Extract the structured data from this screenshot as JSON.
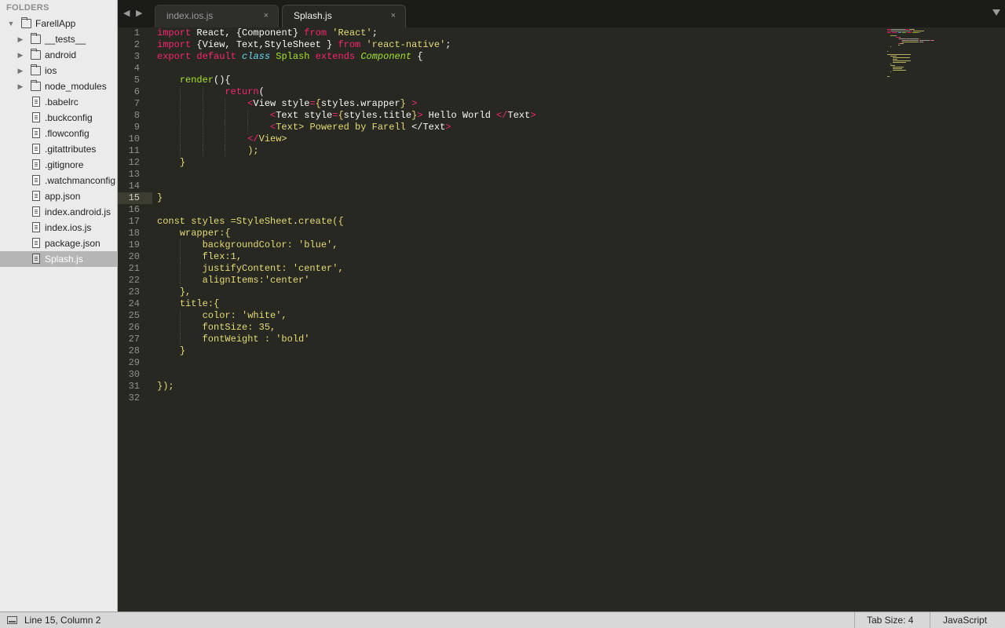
{
  "sidebar": {
    "header": "FOLDERS",
    "items": [
      {
        "label": "FarellApp",
        "type": "folder",
        "expanded": true,
        "depth": 0
      },
      {
        "label": "__tests__",
        "type": "folder",
        "expanded": false,
        "depth": 1
      },
      {
        "label": "android",
        "type": "folder",
        "expanded": false,
        "depth": 1
      },
      {
        "label": "ios",
        "type": "folder",
        "expanded": false,
        "depth": 1
      },
      {
        "label": "node_modules",
        "type": "folder",
        "expanded": false,
        "depth": 1
      },
      {
        "label": ".babelrc",
        "type": "file",
        "depth": 1
      },
      {
        "label": ".buckconfig",
        "type": "file",
        "depth": 1
      },
      {
        "label": ".flowconfig",
        "type": "file",
        "depth": 1
      },
      {
        "label": ".gitattributes",
        "type": "file",
        "depth": 1
      },
      {
        "label": ".gitignore",
        "type": "file",
        "depth": 1
      },
      {
        "label": ".watchmanconfig",
        "type": "file",
        "depth": 1
      },
      {
        "label": "app.json",
        "type": "file",
        "depth": 1
      },
      {
        "label": "index.android.js",
        "type": "file",
        "depth": 1
      },
      {
        "label": "index.ios.js",
        "type": "file",
        "depth": 1
      },
      {
        "label": "package.json",
        "type": "file",
        "depth": 1
      },
      {
        "label": "Splash.js",
        "type": "file",
        "depth": 1,
        "selected": true
      }
    ]
  },
  "tabs": [
    {
      "label": "index.ios.js",
      "active": false,
      "close": "×"
    },
    {
      "label": "Splash.js",
      "active": true,
      "close": "×"
    }
  ],
  "nav": {
    "back": "◀",
    "forward": "▶"
  },
  "editor": {
    "current_line": 15,
    "lines": [
      [
        [
          "kw",
          "import"
        ],
        [
          "plain",
          " React, {Component} "
        ],
        [
          "kw",
          "from"
        ],
        [
          "plain",
          " "
        ],
        [
          "str",
          "'React'"
        ],
        [
          "plain",
          ";"
        ]
      ],
      [
        [
          "kw",
          "import"
        ],
        [
          "plain",
          " {View, Text,StyleSheet } "
        ],
        [
          "kw",
          "from"
        ],
        [
          "plain",
          " "
        ],
        [
          "str",
          "'react-native'"
        ],
        [
          "plain",
          ";"
        ]
      ],
      [
        [
          "kw",
          "export"
        ],
        [
          "plain",
          " "
        ],
        [
          "kw",
          "default"
        ],
        [
          "plain",
          " "
        ],
        [
          "it",
          "class"
        ],
        [
          "plain",
          " "
        ],
        [
          "cls",
          "Splash"
        ],
        [
          "plain",
          " "
        ],
        [
          "kw",
          "extends"
        ],
        [
          "plain",
          " "
        ],
        [
          "itg",
          "Component"
        ],
        [
          "plain",
          " {"
        ]
      ],
      [],
      [
        [
          "plain",
          "    "
        ],
        [
          "fn",
          "render"
        ],
        [
          "plain",
          "(){"
        ]
      ],
      [
        [
          "plain",
          "            "
        ],
        [
          "kw",
          "return"
        ],
        [
          "plain",
          "("
        ]
      ],
      [
        [
          "plain",
          "                "
        ],
        [
          "kw",
          "<"
        ],
        [
          "plain",
          "View style"
        ],
        [
          "kw",
          "="
        ],
        [
          "cur",
          "{"
        ],
        [
          "plain",
          "styles.wrapper"
        ],
        [
          "cur",
          "}"
        ],
        [
          "plain",
          " "
        ],
        [
          "kw",
          ">"
        ]
      ],
      [
        [
          "plain",
          "                    "
        ],
        [
          "kw",
          "<"
        ],
        [
          "plain",
          "Text style"
        ],
        [
          "kw",
          "="
        ],
        [
          "cur",
          "{"
        ],
        [
          "plain",
          "styles.title"
        ],
        [
          "cur",
          "}"
        ],
        [
          "kw",
          ">"
        ],
        [
          "plain",
          " Hello World "
        ],
        [
          "kw",
          "</"
        ],
        [
          "plain",
          "Text"
        ],
        [
          "kw",
          ">"
        ]
      ],
      [
        [
          "plain",
          "                    "
        ],
        [
          "kw",
          "<"
        ],
        [
          "str",
          "Text> Powered by Farell "
        ],
        [
          "plain",
          "</Text"
        ],
        [
          "kw",
          ">"
        ]
      ],
      [
        [
          "plain",
          "                "
        ],
        [
          "kw",
          "</"
        ],
        [
          "str",
          "View>"
        ]
      ],
      [
        [
          "plain",
          "                "
        ],
        [
          "str",
          ");"
        ]
      ],
      [
        [
          "plain",
          "    "
        ],
        [
          "str",
          "}"
        ]
      ],
      [],
      [],
      [
        [
          "str",
          "}"
        ]
      ],
      [],
      [
        [
          "str",
          "const styles =StyleSheet"
        ],
        [
          "plain",
          "."
        ],
        [
          "str",
          "create({"
        ]
      ],
      [
        [
          "plain",
          "    "
        ],
        [
          "str",
          "wrapper:{"
        ]
      ],
      [
        [
          "plain",
          "        "
        ],
        [
          "str",
          "backgroundColor: 'blue',"
        ]
      ],
      [
        [
          "plain",
          "        "
        ],
        [
          "str",
          "flex:1,"
        ]
      ],
      [
        [
          "plain",
          "        "
        ],
        [
          "str",
          "justifyContent: 'center',"
        ]
      ],
      [
        [
          "plain",
          "        "
        ],
        [
          "str",
          "alignItems:'center'"
        ]
      ],
      [
        [
          "plain",
          "    "
        ],
        [
          "str",
          "},"
        ]
      ],
      [
        [
          "plain",
          "    "
        ],
        [
          "str",
          "title:{"
        ]
      ],
      [
        [
          "plain",
          "        "
        ],
        [
          "str",
          "color: 'white',"
        ]
      ],
      [
        [
          "plain",
          "        "
        ],
        [
          "str",
          "fontSize: 35,"
        ]
      ],
      [
        [
          "plain",
          "        "
        ],
        [
          "str",
          "fontWeight : 'bold'"
        ]
      ],
      [
        [
          "plain",
          "    "
        ],
        [
          "str",
          "}"
        ]
      ],
      [],
      [],
      [
        [
          "str",
          "});"
        ]
      ],
      []
    ]
  },
  "statusbar": {
    "position": "Line 15, Column 2",
    "tab_size": "Tab Size: 4",
    "syntax": "JavaScript"
  },
  "colors": {
    "editor_bg": "#272822",
    "keyword": "#f92672",
    "string": "#e6db74",
    "function": "#a6e22e",
    "storage": "#66d9ef",
    "sidebar_bg": "#ebebeb",
    "status_bg": "#d8d8d8"
  }
}
